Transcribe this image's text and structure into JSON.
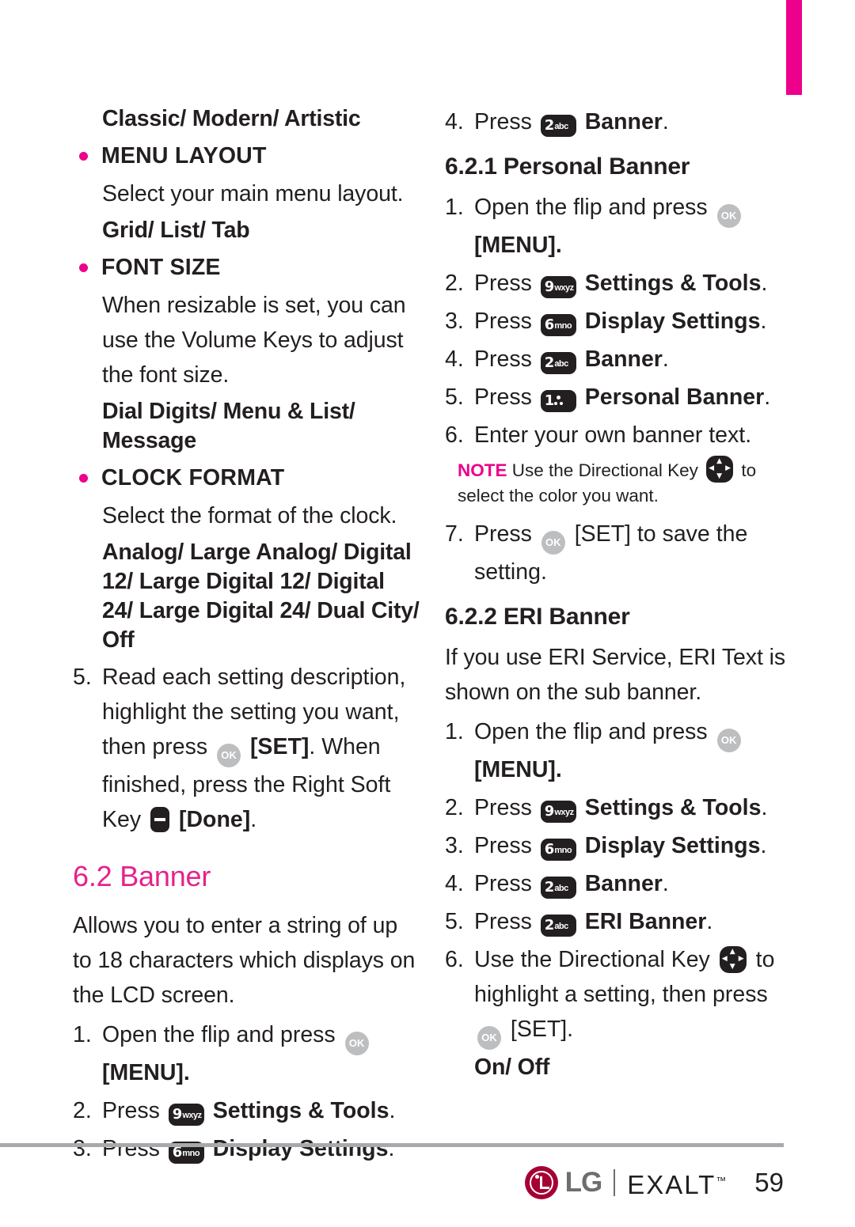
{
  "page": {
    "number": "59",
    "tab_color": "#ec008c",
    "accent_color": "#e6218c",
    "text_color": "#231f20"
  },
  "left_column": {
    "classic_modern_artistic": "Classic/ Modern/ Artistic",
    "menu_layout": {
      "label": "MENU LAYOUT",
      "description": "Select your main menu layout.",
      "options": "Grid/ List/ Tab"
    },
    "font_size": {
      "label": "FONT SIZE",
      "description": "When resizable is set, you can use the Volume Keys to adjust the font size.",
      "options": "Dial Digits/ Menu & List/ Message"
    },
    "clock_format": {
      "label": "CLOCK FORMAT",
      "description": "Select the format of the clock.",
      "options": "Analog/ Large Analog/ Digital 12/ Large Digital 12/ Digital 24/ Large Digital 24/ Dual City/ Off"
    },
    "step5": {
      "num": "5.",
      "part1": "Read each setting description, highlight the setting you want, then press",
      "set_label": "[SET]",
      "part2": ". When finished, press the Right Soft Key",
      "done_label": "[Done]",
      "part3": "."
    },
    "banner_heading": "6.2 Banner",
    "banner_intro": "Allows you to enter a string of up to 18 characters which displays on the LCD screen.",
    "banner_steps": [
      {
        "num": "1.",
        "pre": "Open the flip and press",
        "key": "ok",
        "post": "[MENU]."
      },
      {
        "num": "2.",
        "pre": "Press",
        "key": "9wxyz",
        "post": "Settings & Tools",
        "tail": "."
      },
      {
        "num": "3.",
        "pre": "Press",
        "key": "6mno",
        "post": "Display Settings",
        "tail": "."
      }
    ]
  },
  "right_column": {
    "step4_banner": {
      "num": "4.",
      "pre": "Press",
      "key": "2abc",
      "post": "Banner",
      "tail": "."
    },
    "personal_banner": {
      "heading": "6.2.1 Personal Banner",
      "steps": [
        {
          "num": "1.",
          "pre": "Open the flip and press",
          "key": "ok",
          "post": "[MENU]."
        },
        {
          "num": "2.",
          "pre": "Press",
          "key": "9wxyz",
          "post": "Settings & Tools",
          "tail": "."
        },
        {
          "num": "3.",
          "pre": "Press",
          "key": "6mno",
          "post": "Display Settings",
          "tail": "."
        },
        {
          "num": "4.",
          "pre": "Press",
          "key": "2abc",
          "post": "Banner",
          "tail": "."
        },
        {
          "num": "5.",
          "pre": "Press",
          "key": "1vm",
          "post": "Personal Banner",
          "tail": "."
        },
        {
          "num": "6.",
          "pre": "Enter your own banner text.",
          "key": "",
          "post": ""
        }
      ],
      "note": {
        "tag": "NOTE",
        "part1": "Use the Directional Key",
        "part2": "to select the color you want."
      },
      "step7": {
        "num": "7.",
        "pre": "Press",
        "key": "ok",
        "post": "[SET] to save the setting."
      }
    },
    "eri_banner": {
      "heading": "6.2.2 ERI Banner",
      "intro": "If you use ERI Service, ERI Text is shown on the sub banner.",
      "steps": [
        {
          "num": "1.",
          "pre": "Open the flip and press",
          "key": "ok",
          "post": "[MENU]."
        },
        {
          "num": "2.",
          "pre": "Press",
          "key": "9wxyz",
          "post": "Settings & Tools",
          "tail": "."
        },
        {
          "num": "3.",
          "pre": "Press",
          "key": "6mno",
          "post": "Display Settings",
          "tail": "."
        },
        {
          "num": "4.",
          "pre": "Press",
          "key": "2abc",
          "post": "Banner",
          "tail": "."
        },
        {
          "num": "5.",
          "pre": "Press",
          "key": "2abc",
          "post": "ERI Banner",
          "tail": "."
        }
      ],
      "step6": {
        "num": "6.",
        "part1": "Use the Directional Key",
        "part2": "to highlight a setting, then press",
        "part3": "[SET]."
      },
      "options": "On/ Off"
    }
  },
  "keys": {
    "ok": "OK",
    "k1_num": "1",
    "k2_num": "2",
    "k2_letters": "abc",
    "k6_num": "6",
    "k6_letters": "mno",
    "k9_num": "9",
    "k9_letters": "wxyz",
    "soft_key": "right-soft-key",
    "directional": "directional-key"
  },
  "footer": {
    "brand": "LG",
    "product": "EXALT",
    "tm": "™",
    "page_number": "59"
  }
}
